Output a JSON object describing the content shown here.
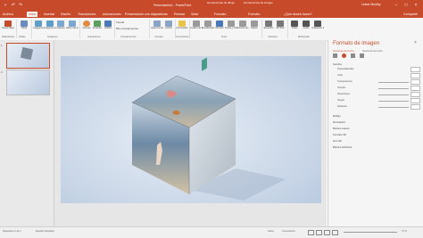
{
  "titlebar": {
    "doc_title": "Presentación1 - PowerPoint",
    "ctx_group_1": "Herramientas de dibujo",
    "ctx_group_2": "Herramientas de imagen",
    "user": "Linear Mouthy"
  },
  "tabs": [
    "Archivo",
    "Inicio",
    "Insertar",
    "Diseño",
    "Transiciones",
    "Animaciones",
    "Presentación con diapositivas",
    "Revisar",
    "Vista",
    "Formato",
    "Formato",
    "¿Qué desea hacer?"
  ],
  "share": "Compartir",
  "ribbon": {
    "buttons": [
      "Nueva diapositiva",
      "Tabla",
      "Imágenes",
      "Imágenes en línea",
      "Captura",
      "Álbum de fotografías",
      "Formas",
      "SmartArt",
      "Gráfico",
      "Complementos",
      "Hipervínculo",
      "Acción",
      "Comentario",
      "Cuadro de texto",
      "Encabezado",
      "WordArt",
      "Fecha y hora",
      "Número de diapositiva",
      "Objeto",
      "Ecuación",
      "Símbolo",
      "Vídeo",
      "Audio",
      "Grabación de pantalla"
    ],
    "store": "Tienda",
    "addins": "Mis complementos",
    "groups": [
      "Diapositivas",
      "Tablas",
      "Imágenes",
      "Ilustraciones",
      "Complementos",
      "Vínculos",
      "Comentarios",
      "Texto",
      "Símbolos",
      "Multimedia"
    ]
  },
  "thumbs": [
    "1",
    "2"
  ],
  "panel": {
    "title": "Formato de imagen",
    "sub1": "Opciones de forma",
    "sub2": "Opciones de texto",
    "sections": [
      "Sombra",
      "Reflejo",
      "Iluminación",
      "Bordes suaves",
      "Formato 3D",
      "Giro 3D",
      "Efectos artísticos"
    ],
    "rows": [
      "Preestablecidos",
      "Color",
      "Transparencia",
      "Tamaño",
      "Desenfoque",
      "Ángulo",
      "Distancia"
    ]
  },
  "status": {
    "slide": "Diapositiva 1 de 2",
    "lang": "Español (España)",
    "notes": "Notas",
    "comments": "Comentarios",
    "zoom": "73 %"
  },
  "colors": {
    "accent": "#c74b2a"
  }
}
